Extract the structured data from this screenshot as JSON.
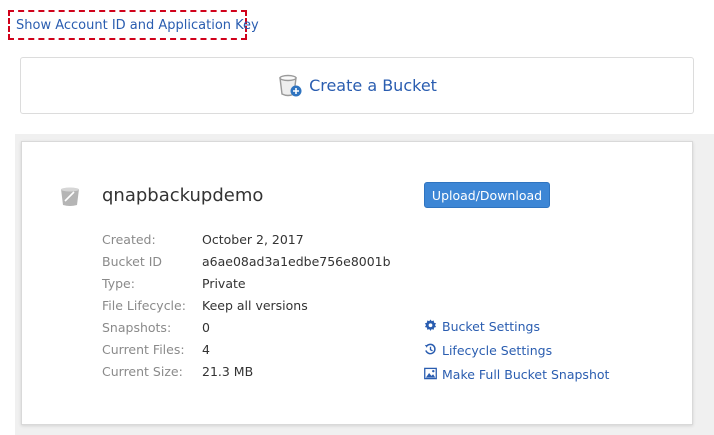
{
  "account": {
    "show_keys_link": "Show Account ID and Application Key"
  },
  "create": {
    "label": "Create a Bucket"
  },
  "bucket": {
    "name": "qnapbackupdemo",
    "upload_label": "Upload/Download",
    "details": [
      {
        "label": "Created:",
        "value": "October 2, 2017"
      },
      {
        "label": "Bucket ID",
        "value": "a6ae08ad3a1edbe756e8001b"
      },
      {
        "label": "Type:",
        "value": "Private"
      },
      {
        "label": "File Lifecycle:",
        "value": "Keep all versions"
      },
      {
        "label": "Snapshots:",
        "value": "0"
      },
      {
        "label": "Current Files:",
        "value": "4"
      },
      {
        "label": "Current Size:",
        "value": "21.3 MB"
      }
    ],
    "links": {
      "settings": "Bucket Settings",
      "lifecycle": "Lifecycle Settings",
      "snapshot": "Make Full Bucket Snapshot"
    }
  },
  "colors": {
    "link": "#2a5db0",
    "button": "#3d86d5",
    "highlight_border": "#d0021b"
  }
}
